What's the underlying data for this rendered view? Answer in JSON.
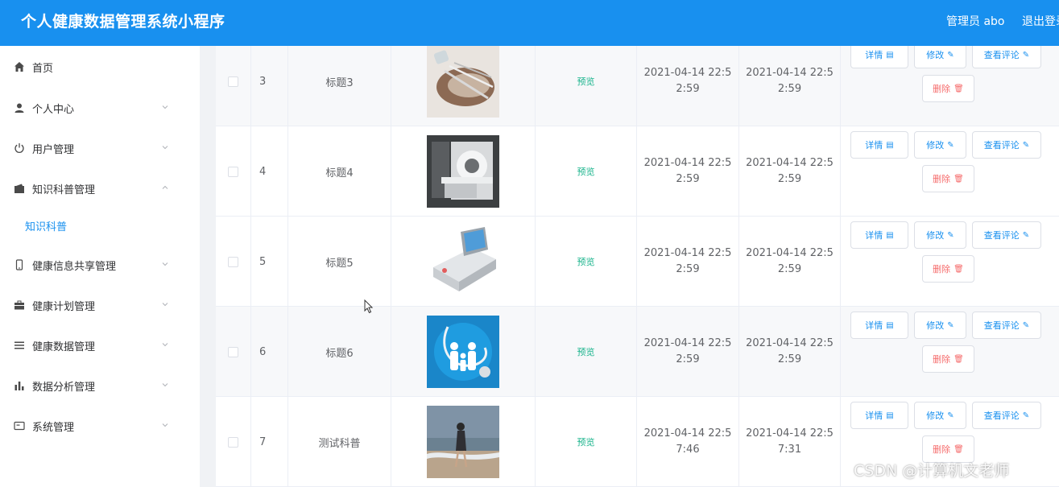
{
  "header": {
    "title": "个人健康数据管理系统小程序",
    "user": "管理员 abo",
    "logout": "退出登录"
  },
  "sidebar": {
    "items": [
      {
        "label": "首页",
        "icon": "home-icon",
        "chevron": ""
      },
      {
        "label": "个人中心",
        "icon": "user-icon",
        "chevron": "down"
      },
      {
        "label": "用户管理",
        "icon": "power-icon",
        "chevron": "down"
      },
      {
        "label": "知识科普管理",
        "icon": "wallet-icon",
        "chevron": "up"
      },
      {
        "label": "知识科普",
        "icon": "",
        "chevron": "",
        "sub": true
      },
      {
        "label": "健康信息共享管理",
        "icon": "phone-icon",
        "chevron": "down"
      },
      {
        "label": "健康计划管理",
        "icon": "briefcase-icon",
        "chevron": "down"
      },
      {
        "label": "健康数据管理",
        "icon": "list-icon",
        "chevron": "down"
      },
      {
        "label": "数据分析管理",
        "icon": "bar-chart-icon",
        "chevron": "down"
      },
      {
        "label": "系统管理",
        "icon": "monitor-icon",
        "chevron": "down"
      }
    ]
  },
  "table": {
    "preview_label": "预览",
    "buttons": {
      "detail": "详情",
      "edit": "修改",
      "review": "查看评论",
      "delete": "删除"
    },
    "rows": [
      {
        "index": "3",
        "title": "标题3",
        "image": "dental-tools-image",
        "created_line1": "2021-04-14 22:5",
        "created_line2": "2:59",
        "updated_line1": "2021-04-14 22:5",
        "updated_line2": "2:59"
      },
      {
        "index": "4",
        "title": "标题4",
        "image": "ct-scanner-image",
        "created_line1": "2021-04-14 22:5",
        "created_line2": "2:59",
        "updated_line1": "2021-04-14 22:5",
        "updated_line2": "2:59"
      },
      {
        "index": "5",
        "title": "标题5",
        "image": "medical-device-image",
        "created_line1": "2021-04-14 22:5",
        "created_line2": "2:59",
        "updated_line1": "2021-04-14 22:5",
        "updated_line2": "2:59"
      },
      {
        "index": "6",
        "title": "标题6",
        "image": "family-stethoscope-image",
        "created_line1": "2021-04-14 22:5",
        "created_line2": "2:59",
        "updated_line1": "2021-04-14 22:5",
        "updated_line2": "2:59"
      },
      {
        "index": "7",
        "title": "测试科普",
        "image": "beach-person-image",
        "created_line1": "2021-04-14 22:5",
        "created_line2": "7:46",
        "updated_line1": "2021-04-14 22:5",
        "updated_line2": "7:31"
      }
    ]
  },
  "watermark": "CSDN @计算机文老师",
  "colors": {
    "primary": "#1890ef",
    "preview": "#18b38b",
    "danger": "#f56c6c"
  }
}
